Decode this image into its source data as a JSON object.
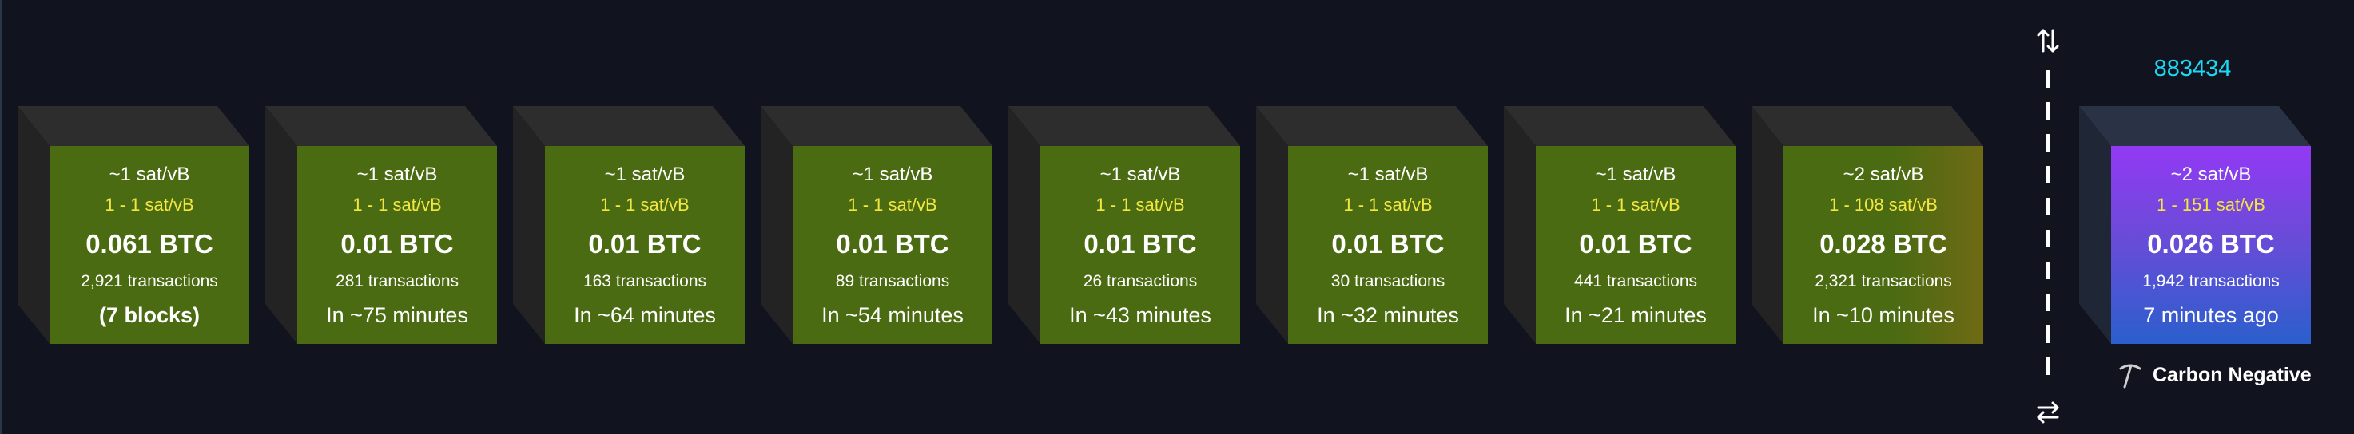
{
  "blocks": [
    {
      "median_fee": "~1 sat/vB",
      "fee_range": "1 - 1 sat/vB",
      "total_fees": "0.061 BTC",
      "tx_count": "2,921 transactions",
      "eta": "(7 blocks)",
      "kind": "pending"
    },
    {
      "median_fee": "~1 sat/vB",
      "fee_range": "1 - 1 sat/vB",
      "total_fees": "0.01 BTC",
      "tx_count": "281 transactions",
      "eta": "In ~75 minutes",
      "kind": "pending"
    },
    {
      "median_fee": "~1 sat/vB",
      "fee_range": "1 - 1 sat/vB",
      "total_fees": "0.01 BTC",
      "tx_count": "163 transactions",
      "eta": "In ~64 minutes",
      "kind": "pending"
    },
    {
      "median_fee": "~1 sat/vB",
      "fee_range": "1 - 1 sat/vB",
      "total_fees": "0.01 BTC",
      "tx_count": "89 transactions",
      "eta": "In ~54 minutes",
      "kind": "pending"
    },
    {
      "median_fee": "~1 sat/vB",
      "fee_range": "1 - 1 sat/vB",
      "total_fees": "0.01 BTC",
      "tx_count": "26 transactions",
      "eta": "In ~43 minutes",
      "kind": "pending"
    },
    {
      "median_fee": "~1 sat/vB",
      "fee_range": "1 - 1 sat/vB",
      "total_fees": "0.01 BTC",
      "tx_count": "30 transactions",
      "eta": "In ~32 minutes",
      "kind": "pending"
    },
    {
      "median_fee": "~1 sat/vB",
      "fee_range": "1 - 1 sat/vB",
      "total_fees": "0.01 BTC",
      "tx_count": "441 transactions",
      "eta": "In ~21 minutes",
      "kind": "pending"
    },
    {
      "median_fee": "~2 sat/vB",
      "fee_range": "1 - 108 sat/vB",
      "total_fees": "0.028 BTC",
      "tx_count": "2,321 transactions",
      "eta": "In ~10 minutes",
      "kind": "pending-next"
    }
  ],
  "mined_block": {
    "height": "883434",
    "median_fee": "~2 sat/vB",
    "fee_range": "1 - 151 sat/vB",
    "total_fees": "0.026 BTC",
    "tx_count": "1,942 transactions",
    "time_ago": "7 minutes ago",
    "pool_name": "Carbon Negative",
    "pool_icon": "pickaxe-icon"
  },
  "icons": {
    "top_toggle": "swap-vertical-arrows-icon",
    "bottom_toggle": "swap-horizontal-arrows-icon"
  },
  "colors": {
    "background": "#11131f",
    "pending_block": "#4a6b12",
    "fee_range": "#f2e640",
    "block_height": "#1bd8f4",
    "mined_gradient_top": "#9339f4",
    "mined_gradient_bottom": "#2b5fcc"
  }
}
